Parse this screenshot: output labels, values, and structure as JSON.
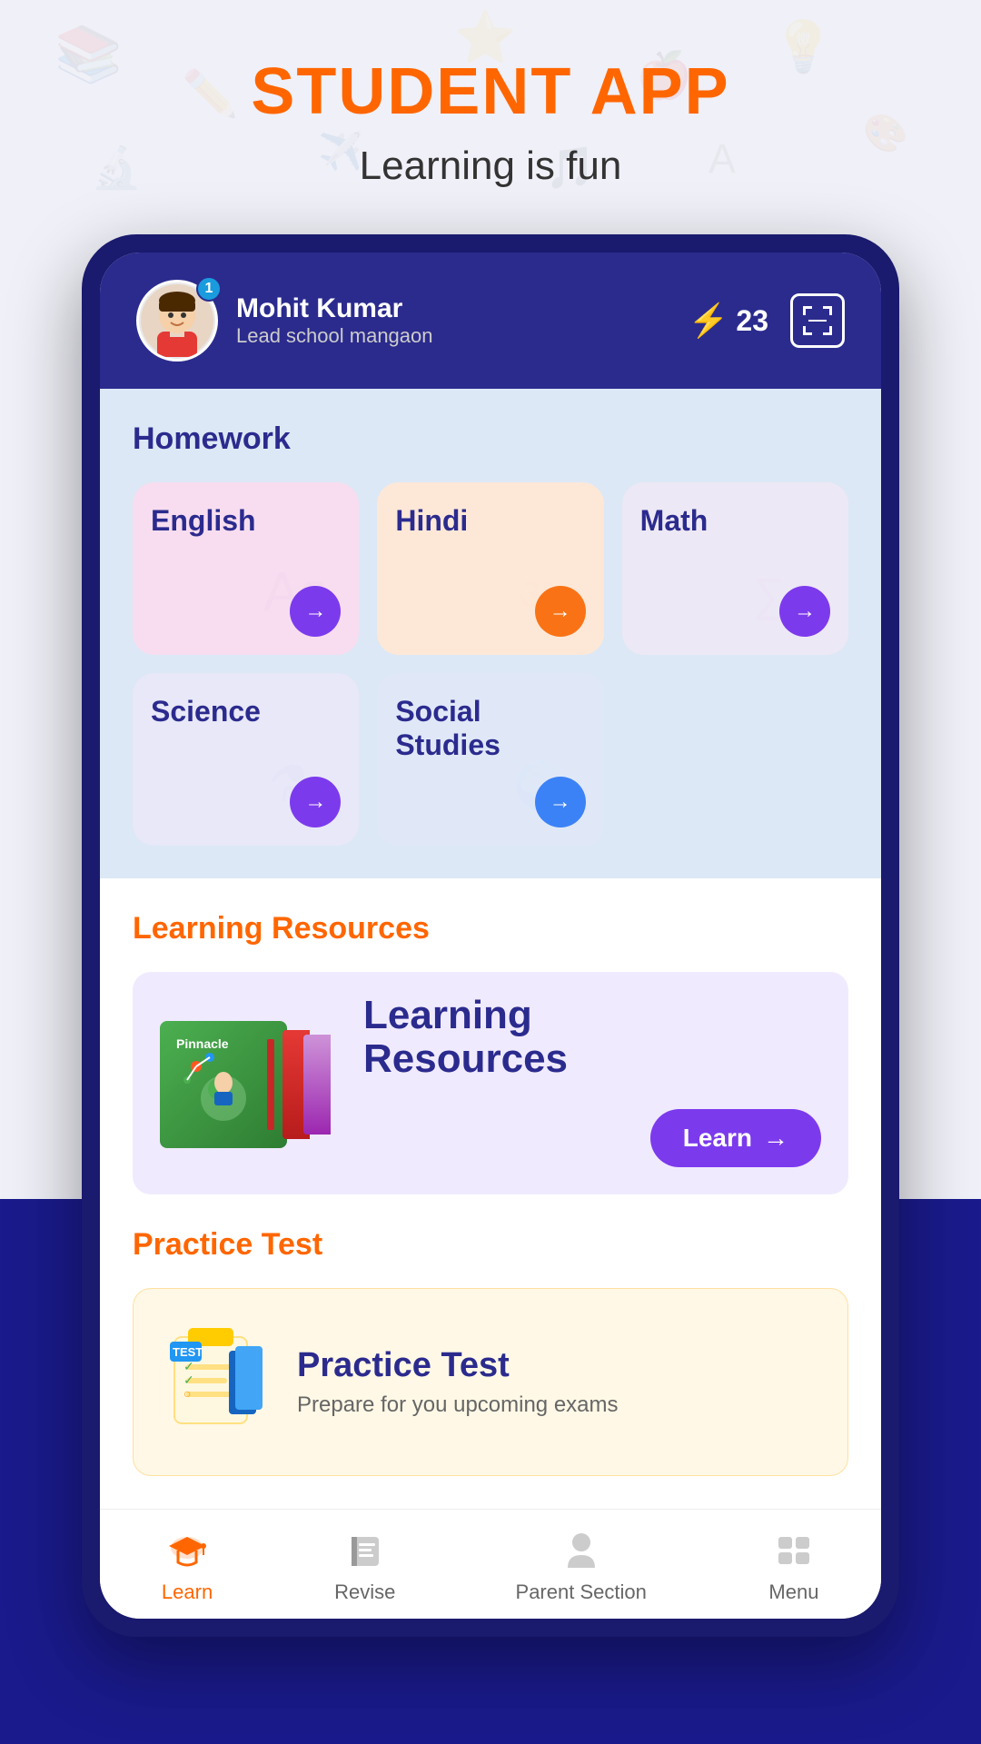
{
  "app": {
    "title": "STUDENT APP",
    "subtitle": "Learning is fun"
  },
  "header": {
    "user_name": "Mohit Kumar",
    "user_school": "Lead school mangaon",
    "notification_count": "1",
    "streak_count": "23"
  },
  "homework": {
    "section_title": "Homework",
    "subjects": [
      {
        "name": "English",
        "color": "english",
        "arrow_color": "purple"
      },
      {
        "name": "Hindi",
        "color": "hindi",
        "arrow_color": "orange"
      },
      {
        "name": "Math",
        "color": "math",
        "arrow_color": "purple"
      },
      {
        "name": "Science",
        "color": "science",
        "arrow_color": "purple"
      },
      {
        "name": "Social Studies",
        "color": "social",
        "arrow_color": "blue"
      }
    ]
  },
  "learning_resources": {
    "section_title": "Learning Resources",
    "card_title_line1": "Learning",
    "card_title_line2": "Resources",
    "pinnacle_label": "Pinnacle",
    "learn_btn": "Learn",
    "arrow": "→"
  },
  "practice_test": {
    "section_title": "Practice Test",
    "card_title": "Practice Test",
    "card_subtitle": "Prepare for you upcoming exams"
  },
  "bottom_nav": {
    "items": [
      {
        "label": "Learn",
        "active": true
      },
      {
        "label": "Revise",
        "active": false
      },
      {
        "label": "Parent Section",
        "active": false
      },
      {
        "label": "Menu",
        "active": false
      }
    ]
  }
}
